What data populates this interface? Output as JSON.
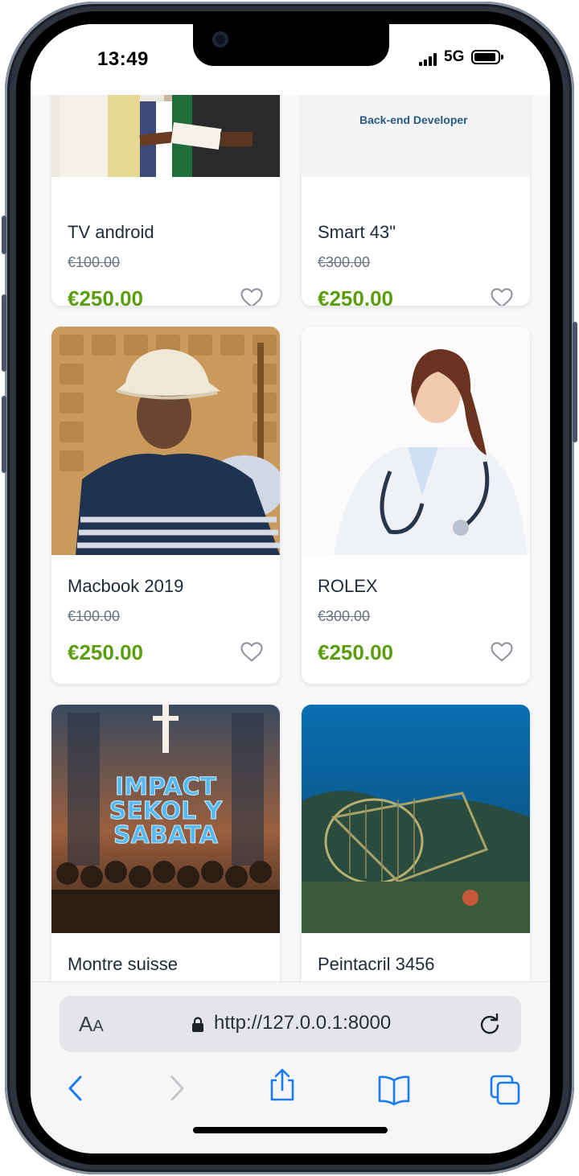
{
  "status_bar": {
    "time": "13:49",
    "network": "5G"
  },
  "products": [
    {
      "title": "TV android",
      "old_price": "€100.00",
      "price": "€250.00",
      "image": "ceremony-photo"
    },
    {
      "title": "Smart 43\"",
      "old_price": "€300.00",
      "price": "€250.00",
      "image": "backend-developer-banner",
      "image_text": "Back-end Developer"
    },
    {
      "title": "Macbook 2019",
      "old_price": "€100.00",
      "price": "€250.00",
      "image": "man-with-hat-photo"
    },
    {
      "title": "ROLEX",
      "old_price": "€300.00",
      "price": "€250.00",
      "image": "doctor-photo"
    },
    {
      "title": "Montre suisse",
      "image": "impact-poster",
      "image_text": "IMPACT SEKOL Y SABATA"
    },
    {
      "title": "Peintacril 3456",
      "image": "underwater-trap-photo"
    }
  ],
  "browser": {
    "text_size_label_big": "A",
    "text_size_label_small": "A",
    "url": "http://127.0.0.1:8000",
    "toolbar": [
      "back-icon",
      "forward-icon",
      "share-icon",
      "bookmarks-icon",
      "tabs-icon"
    ]
  },
  "colors": {
    "price": "#5a9e10",
    "accent": "#1a7cf0"
  }
}
